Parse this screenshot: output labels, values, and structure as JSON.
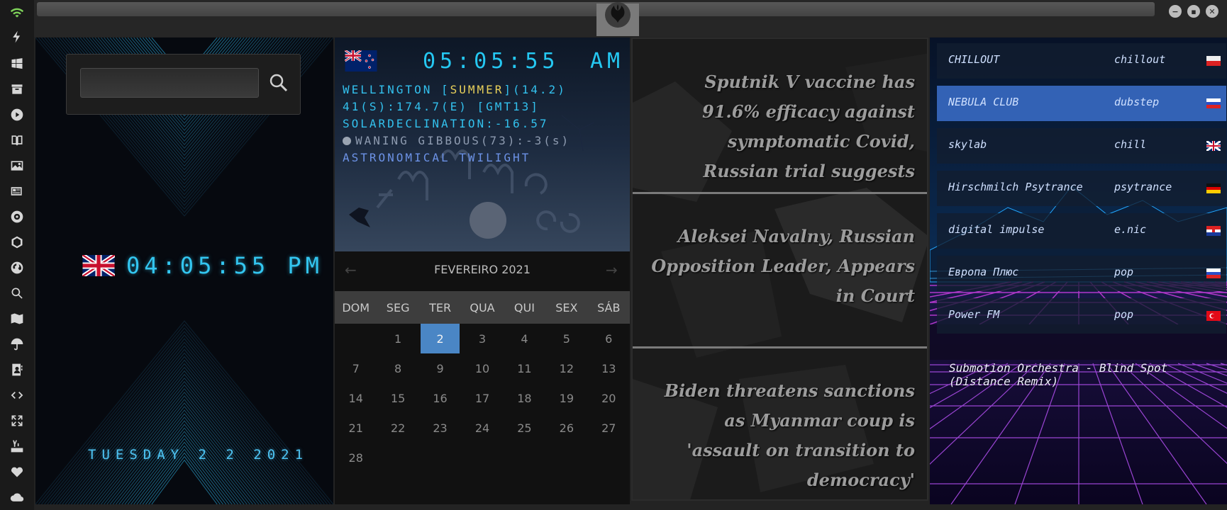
{
  "window": {
    "controls": {
      "minimize": "−",
      "maximize": "▪",
      "close": "✕"
    }
  },
  "sidebar": {
    "icons": [
      "wifi-icon",
      "lightning-icon",
      "windows-icon",
      "archive-icon",
      "play-icon",
      "book-icon",
      "image-icon",
      "news-icon",
      "settings-icon",
      "hexagon-icon",
      "globe-icon",
      "search-icon",
      "map-icon",
      "umbrella-icon",
      "contacts-icon",
      "code-icon",
      "expand-icon",
      "youtube-icon",
      "heart-icon",
      "cloud-icon"
    ]
  },
  "search": {
    "placeholder": "",
    "value": ""
  },
  "local_clock": {
    "time": "04:05:55 PM",
    "date": "TUESDAY 2 2 2021"
  },
  "astro": {
    "time": "05:05:55",
    "ampm": "AM",
    "location_prefix": "WELLINGTON [",
    "season": "SUMMER",
    "location_suffix": "](14.2)",
    "coords": "41(S):174.7(E) [GMT13]",
    "declination": "SOLARDECLINATION:-16.57",
    "moon": "WANING GIBBOUS(73):-3(s)",
    "twilight": "ASTRONOMICAL TWILIGHT"
  },
  "calendar": {
    "month_label": "FEVEREIRO 2021",
    "prev": "←",
    "next": "→",
    "weekdays": [
      "DOM",
      "SEG",
      "TER",
      "QUA",
      "QUI",
      "SEX",
      "SÁB"
    ],
    "days": [
      "",
      "1",
      "2",
      "3",
      "4",
      "5",
      "6",
      "7",
      "8",
      "9",
      "10",
      "11",
      "12",
      "13",
      "14",
      "15",
      "16",
      "17",
      "18",
      "19",
      "20",
      "21",
      "22",
      "23",
      "24",
      "25",
      "26",
      "27",
      "28"
    ],
    "today": "2"
  },
  "news": [
    "Sputnik V vaccine has 91.6% efficacy against symptomatic Covid, Russian trial suggests",
    "Aleksei Navalny, Russian Opposition Leader, Appears in Court",
    "Biden threatens sanctions as Myanmar coup is 'assault on transition to democracy'"
  ],
  "radio": {
    "stations": [
      {
        "name": "CHILLOUT",
        "genre": "chillout",
        "flag": "poland"
      },
      {
        "name": "NEBULA CLUB",
        "genre": "dubstep",
        "flag": "russia"
      },
      {
        "name": "skylab",
        "genre": "chill",
        "flag": "uk"
      },
      {
        "name": "Hirschmilch Psytrance",
        "genre": "psytrance",
        "flag": "germany"
      },
      {
        "name": "digital impulse",
        "genre": "e.nic",
        "flag": "croatia"
      },
      {
        "name": "Европа Плюс",
        "genre": "pop",
        "flag": "russia"
      },
      {
        "name": "Power FM",
        "genre": "pop",
        "flag": "turkey"
      }
    ],
    "active_index": 1,
    "now_playing": "Submotion Orchestra - Blind Spot (Distance Remix)"
  },
  "colors": {
    "clock_cyan": "#33c6f0",
    "season_yellow": "#e8d05a",
    "calendar_today": "#4a86c5",
    "radio_active": "#3362b5"
  }
}
